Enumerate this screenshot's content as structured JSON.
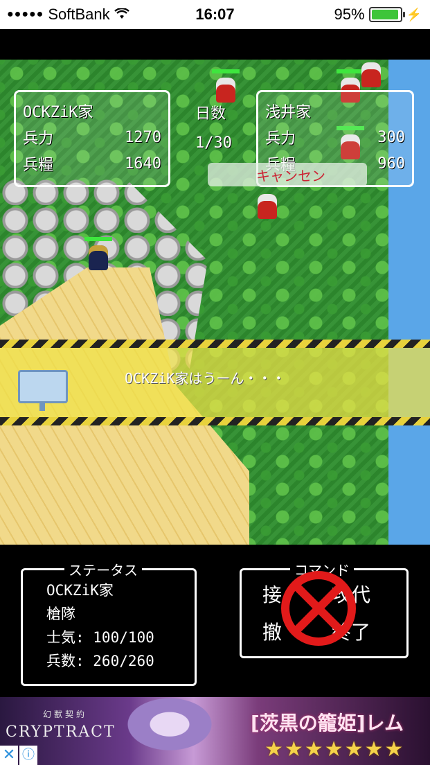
{
  "status_bar": {
    "signal_dots": "●●●●●",
    "carrier": "SoftBank",
    "time": "16:07",
    "battery_percent": "95%",
    "battery_level": 0.95
  },
  "map": {
    "player_panel": {
      "name": "OCKZiK家",
      "troops_label": "兵力",
      "troops_value": "1270",
      "food_label": "兵糧",
      "food_value": "1640"
    },
    "day_panel": {
      "label": "日数",
      "value": "1/30"
    },
    "enemy_panel": {
      "name": "浅井家",
      "troops_label": "兵力",
      "troops_value": "300",
      "food_label": "兵糧",
      "food_value": "960"
    },
    "cancel_toast": "キャンセン"
  },
  "banner": {
    "message": "OCKZiK家はうーん・・・"
  },
  "status_box": {
    "title": "ステータス",
    "house": "OCKZiK家",
    "unit_type": "槍隊",
    "morale": "士気: 100/100",
    "soldiers": "兵数: 260/260"
  },
  "command_box": {
    "title": "コマンド",
    "commands": [
      "接",
      "攻代",
      "撤",
      "終了"
    ]
  },
  "ad": {
    "logo_sub": "幻獣契約",
    "logo": "CRYPTRACT",
    "title": "[茨黒の籠姫]レム",
    "stars": "★★★★★★★",
    "close": "✕",
    "info": "ⓘ"
  },
  "colors": {
    "hp_bar": "#3ee63e",
    "enemy": "#c8251f",
    "no_symbol": "#e21a1a",
    "stripe_yellow": "#e8d23c"
  }
}
